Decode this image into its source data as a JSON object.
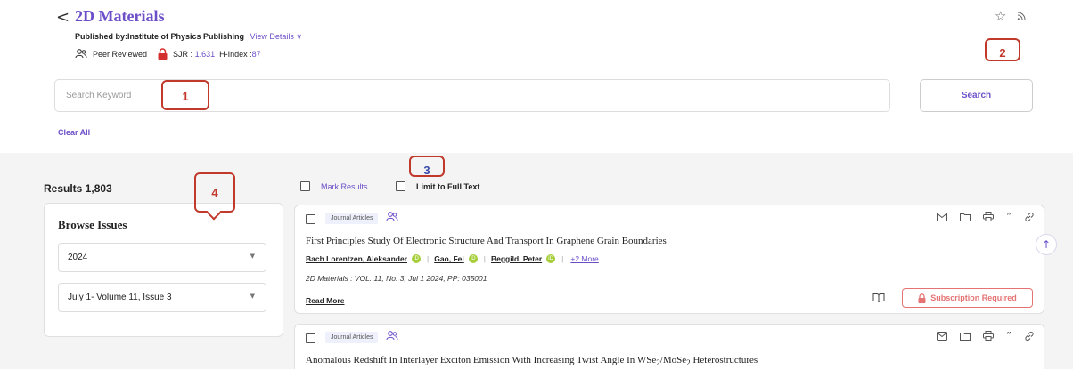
{
  "journal": {
    "back_glyph": "<",
    "title": "2D Materials",
    "publisher_label": "Published by:Institute of Physics Publishing",
    "view_details": "View Details",
    "peer_reviewed": "Peer Reviewed",
    "sjr_label": "SJR :",
    "sjr_value": "1.631",
    "h_label": "H-Index :",
    "h_value": "87"
  },
  "header_actions": {
    "star_icon": "star-icon",
    "rss_icon": "rss-icon"
  },
  "search": {
    "placeholder": "Search Keyword",
    "value": "",
    "button_label": "Search",
    "clear_all": "Clear All"
  },
  "annotations": [
    "1",
    "2",
    "3",
    "4"
  ],
  "results": {
    "count_label": "Results 1,803",
    "mark_results": "Mark Results",
    "limit_full_text": "Limit to Full Text"
  },
  "browse": {
    "title": "Browse Issues",
    "year": "2024",
    "issue": "July 1- Volume 11, Issue 3"
  },
  "articles": [
    {
      "tag": "Journal Articles",
      "title": "First Principles Study Of Electronic Structure And Transport In Graphene Grain Boundaries",
      "authors": [
        "Bach Lorentzen, Aleksander",
        "Gao, Fei",
        "Beggild, Peter"
      ],
      "more": "+2 More",
      "citation": "2D Materials : VOL. 11, No. 3, Jul 1 2024, PP: 035001",
      "read_more": "Read More",
      "access": "Subscription Required"
    },
    {
      "tag": "Journal Articles",
      "title_prefix": "Anomalous Redshift In Interlayer Exciton Emission With Increasing Twist Angle In WSe",
      "title_sub1": "2",
      "title_mid": "/MoSe",
      "title_sub2": "2",
      "title_suffix": " Heterostructures"
    }
  ],
  "colors": {
    "accent": "#6c4fc8",
    "annotation": "#c0392b",
    "subscription": "#e57373"
  }
}
